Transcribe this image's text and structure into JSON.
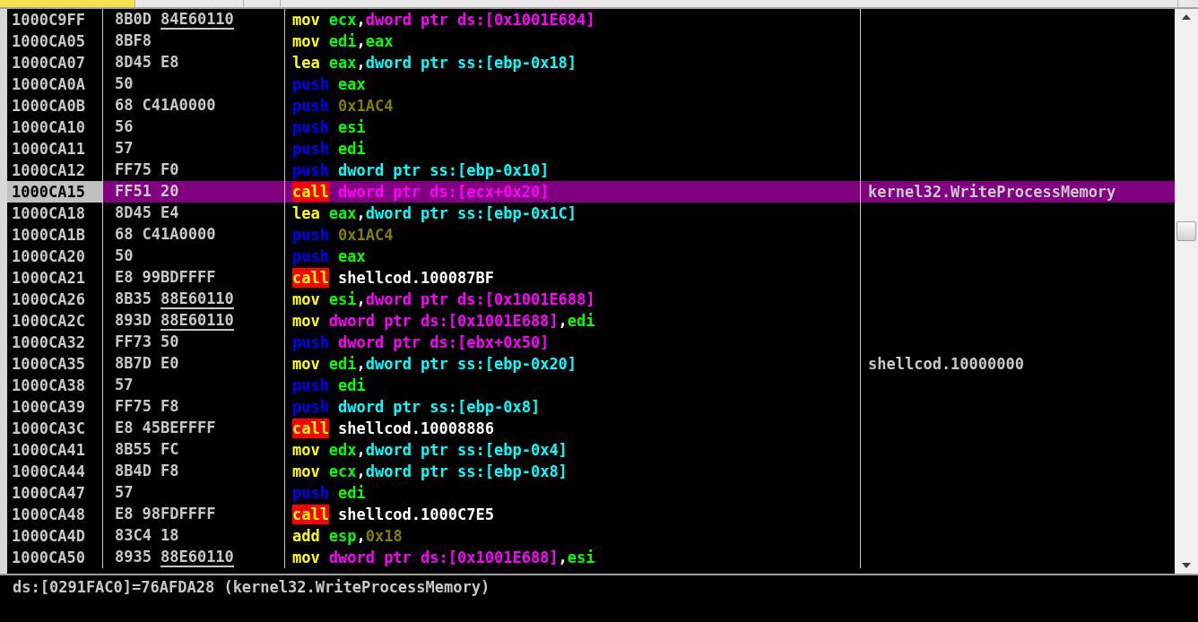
{
  "rows": [
    {
      "address": "1000C9FF",
      "bytes": [
        {
          "text": "8B0D",
          "underline": false
        },
        {
          "text": "84E60110",
          "underline": true
        }
      ],
      "mnemonic": {
        "text": "mov",
        "kind": "op"
      },
      "operands": [
        {
          "text": "ecx",
          "kind": "reg"
        },
        {
          "text": ",",
          "kind": "sep"
        },
        {
          "text": "dword ptr ds:[0x1001E684]",
          "kind": "ds"
        }
      ],
      "selected": false
    },
    {
      "address": "1000CA05",
      "bytes": [
        {
          "text": "8BF8",
          "underline": false
        }
      ],
      "mnemonic": {
        "text": "mov",
        "kind": "op"
      },
      "operands": [
        {
          "text": "edi",
          "kind": "reg"
        },
        {
          "text": ",",
          "kind": "sep"
        },
        {
          "text": "eax",
          "kind": "reg"
        }
      ],
      "selected": false
    },
    {
      "address": "1000CA07",
      "bytes": [
        {
          "text": "8D45",
          "underline": false
        },
        {
          "text": "E8",
          "underline": false
        }
      ],
      "mnemonic": {
        "text": "lea",
        "kind": "op"
      },
      "operands": [
        {
          "text": "eax",
          "kind": "reg"
        },
        {
          "text": ",",
          "kind": "sep"
        },
        {
          "text": "dword ptr ss:[ebp-0x18]",
          "kind": "ss"
        }
      ],
      "selected": false
    },
    {
      "address": "1000CA0A",
      "bytes": [
        {
          "text": "50",
          "underline": false
        }
      ],
      "mnemonic": {
        "text": "push",
        "kind": "push"
      },
      "operands": [
        {
          "text": "eax",
          "kind": "reg"
        }
      ],
      "selected": false
    },
    {
      "address": "1000CA0B",
      "bytes": [
        {
          "text": "68",
          "underline": false
        },
        {
          "text": "C41A0000",
          "underline": false
        }
      ],
      "mnemonic": {
        "text": "push",
        "kind": "push"
      },
      "operands": [
        {
          "text": "0x1AC4",
          "kind": "imm"
        }
      ],
      "selected": false
    },
    {
      "address": "1000CA10",
      "bytes": [
        {
          "text": "56",
          "underline": false
        }
      ],
      "mnemonic": {
        "text": "push",
        "kind": "push"
      },
      "operands": [
        {
          "text": "esi",
          "kind": "reg"
        }
      ],
      "selected": false
    },
    {
      "address": "1000CA11",
      "bytes": [
        {
          "text": "57",
          "underline": false
        }
      ],
      "mnemonic": {
        "text": "push",
        "kind": "push"
      },
      "operands": [
        {
          "text": "edi",
          "kind": "reg"
        }
      ],
      "selected": false
    },
    {
      "address": "1000CA12",
      "bytes": [
        {
          "text": "FF75",
          "underline": false
        },
        {
          "text": "F0",
          "underline": false
        }
      ],
      "mnemonic": {
        "text": "push",
        "kind": "push"
      },
      "operands": [
        {
          "text": "dword ptr ss:[ebp-0x10]",
          "kind": "ss"
        }
      ],
      "selected": false
    },
    {
      "address": "1000CA15",
      "bytes": [
        {
          "text": "FF51",
          "underline": false
        },
        {
          "text": "20",
          "underline": false
        }
      ],
      "mnemonic": {
        "text": "call",
        "kind": "call"
      },
      "operands": [
        {
          "text": "dword ptr ds:[ecx+0x20]",
          "kind": "ds"
        }
      ],
      "comment": "kernel32.WriteProcessMemory",
      "selected": true
    },
    {
      "address": "1000CA18",
      "bytes": [
        {
          "text": "8D45",
          "underline": false
        },
        {
          "text": "E4",
          "underline": false
        }
      ],
      "mnemonic": {
        "text": "lea",
        "kind": "op"
      },
      "operands": [
        {
          "text": "eax",
          "kind": "reg"
        },
        {
          "text": ",",
          "kind": "sep"
        },
        {
          "text": "dword ptr ss:[ebp-0x1C]",
          "kind": "ss"
        }
      ],
      "selected": false
    },
    {
      "address": "1000CA1B",
      "bytes": [
        {
          "text": "68",
          "underline": false
        },
        {
          "text": "C41A0000",
          "underline": false
        }
      ],
      "mnemonic": {
        "text": "push",
        "kind": "push"
      },
      "operands": [
        {
          "text": "0x1AC4",
          "kind": "imm"
        }
      ],
      "selected": false
    },
    {
      "address": "1000CA20",
      "bytes": [
        {
          "text": "50",
          "underline": false
        }
      ],
      "mnemonic": {
        "text": "push",
        "kind": "push"
      },
      "operands": [
        {
          "text": "eax",
          "kind": "reg"
        }
      ],
      "selected": false
    },
    {
      "address": "1000CA21",
      "bytes": [
        {
          "text": "E8",
          "underline": false
        },
        {
          "text": "99BDFFFF",
          "underline": false
        }
      ],
      "mnemonic": {
        "text": "call",
        "kind": "call"
      },
      "operands": [
        {
          "text": "shellcod.100087BF",
          "kind": "sym"
        }
      ],
      "selected": false
    },
    {
      "address": "1000CA26",
      "bytes": [
        {
          "text": "8B35",
          "underline": false
        },
        {
          "text": "88E60110",
          "underline": true
        }
      ],
      "mnemonic": {
        "text": "mov",
        "kind": "op"
      },
      "operands": [
        {
          "text": "esi",
          "kind": "reg"
        },
        {
          "text": ",",
          "kind": "sep"
        },
        {
          "text": "dword ptr ds:[0x1001E688]",
          "kind": "ds"
        }
      ],
      "selected": false
    },
    {
      "address": "1000CA2C",
      "bytes": [
        {
          "text": "893D",
          "underline": false
        },
        {
          "text": "88E60110",
          "underline": true
        }
      ],
      "mnemonic": {
        "text": "mov",
        "kind": "op"
      },
      "operands": [
        {
          "text": "dword ptr ds:[0x1001E688]",
          "kind": "ds"
        },
        {
          "text": ",",
          "kind": "sep"
        },
        {
          "text": "edi",
          "kind": "reg"
        }
      ],
      "selected": false
    },
    {
      "address": "1000CA32",
      "bytes": [
        {
          "text": "FF73",
          "underline": false
        },
        {
          "text": "50",
          "underline": false
        }
      ],
      "mnemonic": {
        "text": "push",
        "kind": "push"
      },
      "operands": [
        {
          "text": "dword ptr ds:[ebx+0x50]",
          "kind": "ds"
        }
      ],
      "selected": false
    },
    {
      "address": "1000CA35",
      "bytes": [
        {
          "text": "8B7D",
          "underline": false
        },
        {
          "text": "E0",
          "underline": false
        }
      ],
      "mnemonic": {
        "text": "mov",
        "kind": "op"
      },
      "operands": [
        {
          "text": "edi",
          "kind": "reg"
        },
        {
          "text": ",",
          "kind": "sep"
        },
        {
          "text": "dword ptr ss:[ebp-0x20]",
          "kind": "ss"
        }
      ],
      "comment": "shellcod.10000000",
      "selected": false
    },
    {
      "address": "1000CA38",
      "bytes": [
        {
          "text": "57",
          "underline": false
        }
      ],
      "mnemonic": {
        "text": "push",
        "kind": "push"
      },
      "operands": [
        {
          "text": "edi",
          "kind": "reg"
        }
      ],
      "selected": false
    },
    {
      "address": "1000CA39",
      "bytes": [
        {
          "text": "FF75",
          "underline": false
        },
        {
          "text": "F8",
          "underline": false
        }
      ],
      "mnemonic": {
        "text": "push",
        "kind": "push"
      },
      "operands": [
        {
          "text": "dword ptr ss:[ebp-0x8]",
          "kind": "ss"
        }
      ],
      "selected": false
    },
    {
      "address": "1000CA3C",
      "bytes": [
        {
          "text": "E8",
          "underline": false
        },
        {
          "text": "45BEFFFF",
          "underline": false
        }
      ],
      "mnemonic": {
        "text": "call",
        "kind": "call"
      },
      "operands": [
        {
          "text": "shellcod.10008886",
          "kind": "sym"
        }
      ],
      "selected": false
    },
    {
      "address": "1000CA41",
      "bytes": [
        {
          "text": "8B55",
          "underline": false
        },
        {
          "text": "FC",
          "underline": false
        }
      ],
      "mnemonic": {
        "text": "mov",
        "kind": "op"
      },
      "operands": [
        {
          "text": "edx",
          "kind": "reg"
        },
        {
          "text": ",",
          "kind": "sep"
        },
        {
          "text": "dword ptr ss:[ebp-0x4]",
          "kind": "ss"
        }
      ],
      "selected": false
    },
    {
      "address": "1000CA44",
      "bytes": [
        {
          "text": "8B4D",
          "underline": false
        },
        {
          "text": "F8",
          "underline": false
        }
      ],
      "mnemonic": {
        "text": "mov",
        "kind": "op"
      },
      "operands": [
        {
          "text": "ecx",
          "kind": "reg"
        },
        {
          "text": ",",
          "kind": "sep"
        },
        {
          "text": "dword ptr ss:[ebp-0x8]",
          "kind": "ss"
        }
      ],
      "selected": false
    },
    {
      "address": "1000CA47",
      "bytes": [
        {
          "text": "57",
          "underline": false
        }
      ],
      "mnemonic": {
        "text": "push",
        "kind": "push"
      },
      "operands": [
        {
          "text": "edi",
          "kind": "reg"
        }
      ],
      "selected": false
    },
    {
      "address": "1000CA48",
      "bytes": [
        {
          "text": "E8",
          "underline": false
        },
        {
          "text": "98FDFFFF",
          "underline": false
        }
      ],
      "mnemonic": {
        "text": "call",
        "kind": "call"
      },
      "operands": [
        {
          "text": "shellcod.1000C7E5",
          "kind": "sym"
        }
      ],
      "selected": false
    },
    {
      "address": "1000CA4D",
      "bytes": [
        {
          "text": "83C4",
          "underline": false
        },
        {
          "text": "18",
          "underline": false
        }
      ],
      "mnemonic": {
        "text": "add",
        "kind": "op"
      },
      "operands": [
        {
          "text": "esp",
          "kind": "reg"
        },
        {
          "text": ",",
          "kind": "sep"
        },
        {
          "text": "0x18",
          "kind": "imm"
        }
      ],
      "selected": false
    },
    {
      "address": "1000CA50",
      "bytes": [
        {
          "text": "8935",
          "underline": false
        },
        {
          "text": "88E60110",
          "underline": true
        }
      ],
      "mnemonic": {
        "text": "mov",
        "kind": "op"
      },
      "operands": [
        {
          "text": "dword ptr ds:[0x1001E688]",
          "kind": "ds"
        },
        {
          "text": ",",
          "kind": "sep"
        },
        {
          "text": "esi",
          "kind": "reg"
        }
      ],
      "selected": false
    }
  ],
  "info_pane": {
    "text": "ds:[0291FAC0]=76AFDA28 (kernel32.WriteProcessMemory)"
  }
}
